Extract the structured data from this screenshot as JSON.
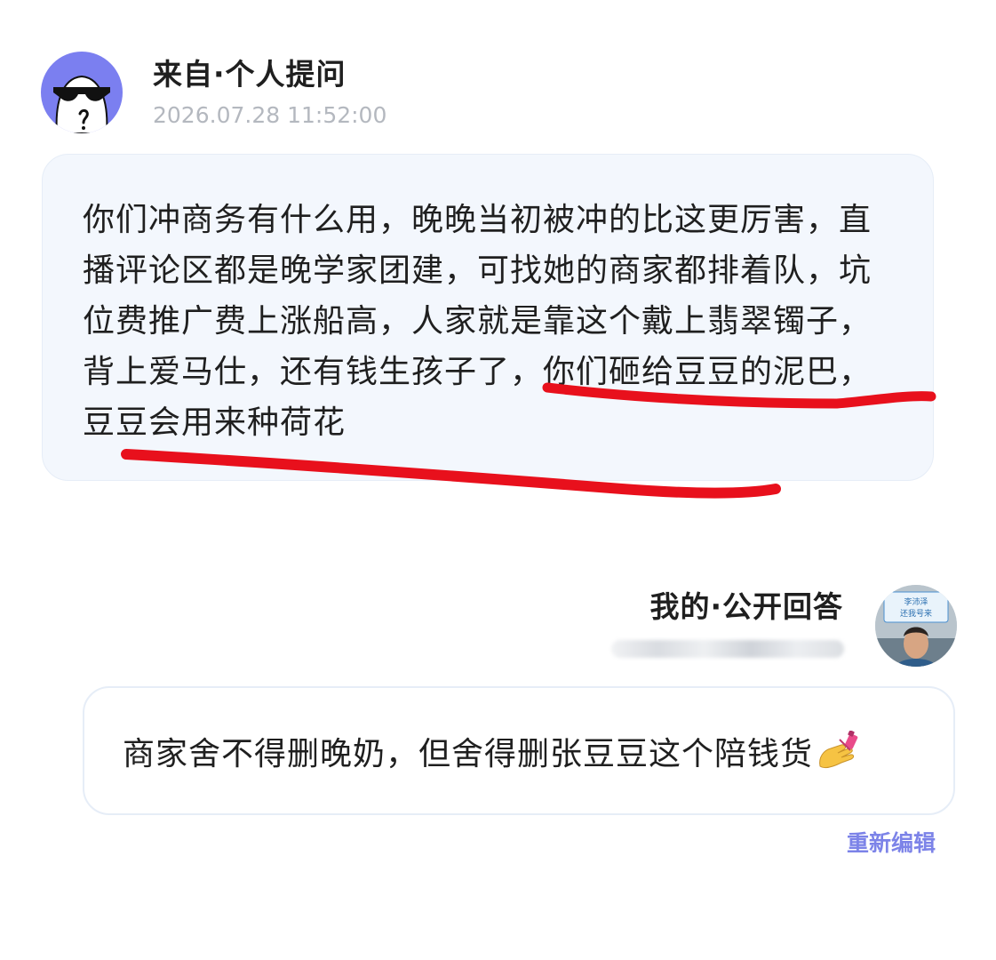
{
  "question": {
    "source_label": "来自·个人提问",
    "timestamp": "2026.07.28 11:52:00",
    "text": "你们冲商务有什么用，晚晚当初被冲的比这更厉害，直播评论区都是晚学家团建，可找她的商家都排着队，坑位费推广费上涨船高，人家就是靠这个戴上翡翠镯子，背上爱马仕，还有钱生孩子了，你们砸给豆豆的泥巴，豆豆会用来种荷花",
    "avatar_icon": "sunglasses-face-icon",
    "avatar_color": "#7b7ff0"
  },
  "answer": {
    "label": "我的·公开回答",
    "avatar_sign_text": "李沛泽\n还我号来",
    "text": "商家舍不得删晚奶，但舍得删张豆豆这个陪钱货",
    "emoji_icon": "nail-polish-icon",
    "edit_label": "重新编辑"
  },
  "colors": {
    "accent": "#7c83e8",
    "bubble_bg": "#f3f7fd",
    "marker": "#e8101c",
    "timestamp": "#b4b8bf"
  }
}
